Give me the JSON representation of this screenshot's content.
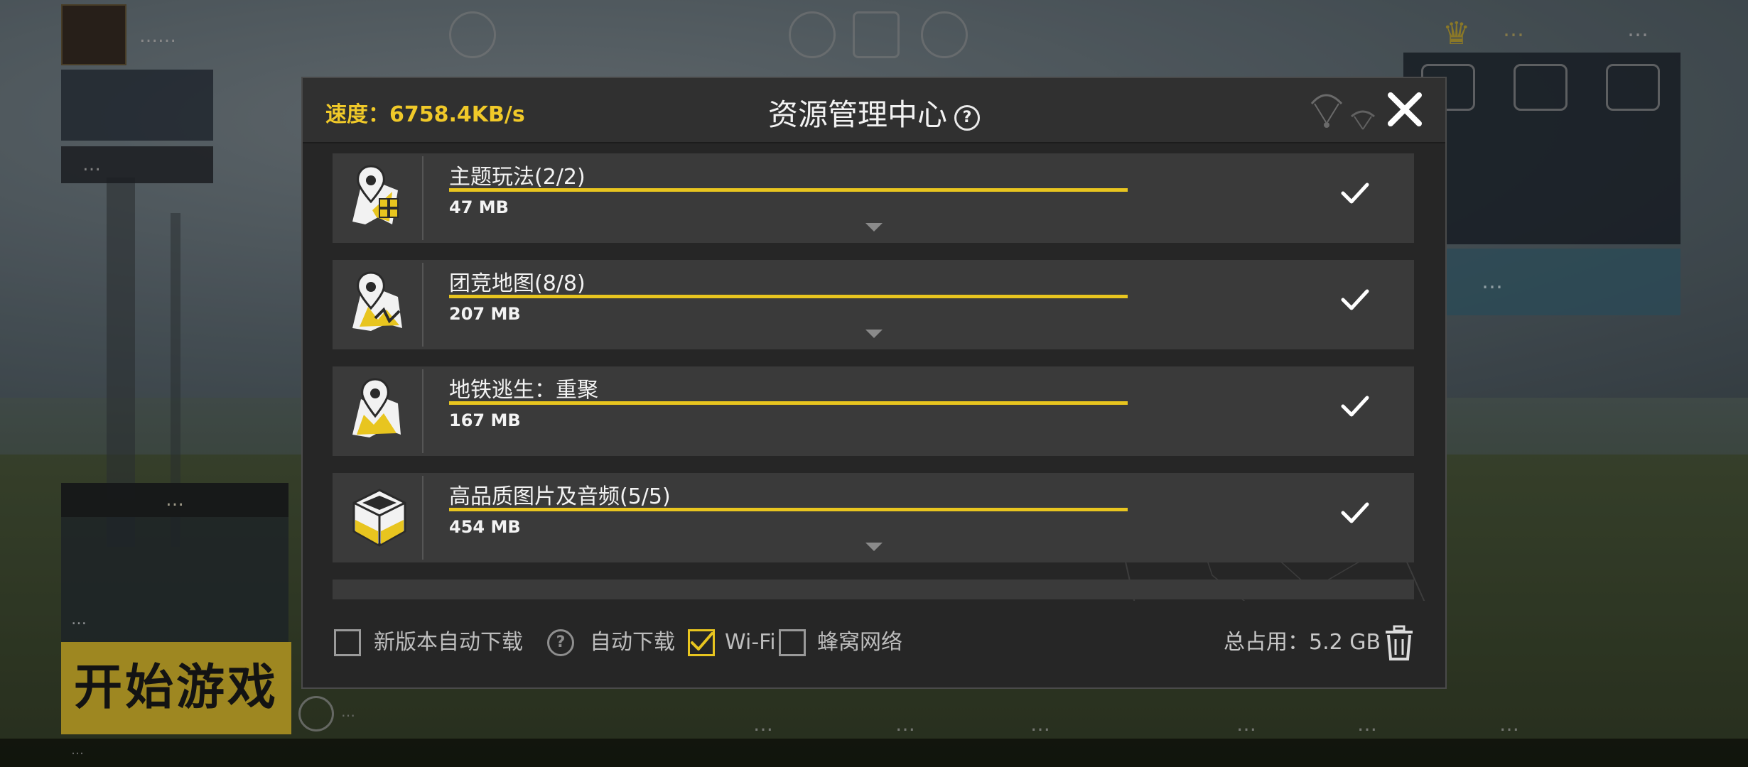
{
  "background": {
    "player_name": "……",
    "side_chip": "…",
    "news_title": "…",
    "news_caption": "…",
    "start_button": "开始游戏",
    "right_banner": "…",
    "currency_a": "…",
    "currency_b": "…",
    "bottom_nav": [
      "…",
      "…",
      "…",
      "…",
      "…",
      "…"
    ],
    "bottom_meta": "…",
    "team_text": "…"
  },
  "dialog": {
    "speed": "速度：6758.4KB/s",
    "title": "资源管理中心",
    "help_glyph": "?",
    "close_glyph": "✕",
    "items": [
      {
        "title": "主题玩法(2/2)",
        "size": "47 MB",
        "progress": 1.0,
        "icon": "map-pin-grid-icon",
        "expandable": true
      },
      {
        "title": "团竞地图(8/8)",
        "size": "207 MB",
        "progress": 1.0,
        "icon": "map-pin-route-icon",
        "expandable": true
      },
      {
        "title": "地铁逃生：重聚",
        "size": "167 MB",
        "progress": 1.0,
        "icon": "map-pin-icon",
        "expandable": false
      },
      {
        "title": "高品质图片及音频(5/5)",
        "size": "454 MB",
        "progress": 1.0,
        "icon": "cube-icon",
        "expandable": true
      }
    ],
    "footer": {
      "auto_update_label": "新版本自动下载",
      "auto_update_checked": false,
      "auto_download_label": "自动下载",
      "wifi_label": "Wi-Fi",
      "wifi_checked": true,
      "cellular_label": "蜂窝网络",
      "cellular_checked": false,
      "total_label": "总占用：5.2 GB"
    }
  },
  "colors": {
    "accent": "#e8c51f",
    "speed_text": "#f0c929",
    "row_bg": "#3a3a3a",
    "dialog_bg": "#262626"
  }
}
